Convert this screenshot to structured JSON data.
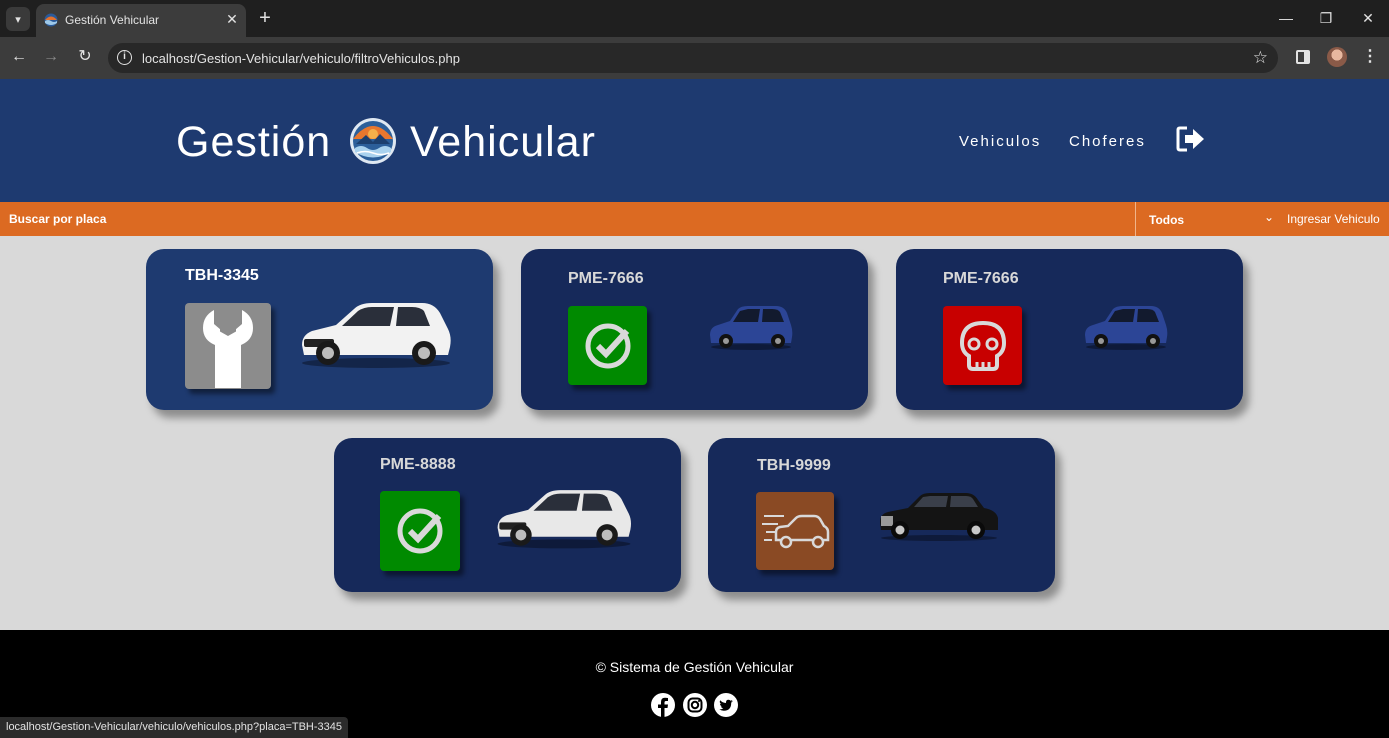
{
  "browser": {
    "tab_title": "Gestión Vehicular",
    "url": "localhost/Gestion-Vehicular/vehiculo/filtroVehiculos.php",
    "status_url": "localhost/Gestion-Vehicular/vehiculo/vehiculos.php?placa=TBH-3345",
    "icons": [
      "tab-menu-icon",
      "close-icon",
      "plus-icon",
      "minimize-icon",
      "restore-icon",
      "close-window-icon",
      "back-icon",
      "forward-icon",
      "reload-icon",
      "info-icon",
      "star-icon",
      "side-panel-icon",
      "kebab-icon"
    ]
  },
  "header": {
    "brand_left": "Gestión",
    "brand_right": "Vehicular",
    "nav": [
      "Vehiculos",
      "Choferes"
    ],
    "logout_icon": "logout-icon"
  },
  "filter_bar": {
    "search_label": "Buscar por placa",
    "select_value": "Todos",
    "add_label": "Ingresar Vehiculo"
  },
  "vehicles": [
    {
      "plate": "TBH-3345",
      "status": "maintenance",
      "status_icon": "wrench-icon",
      "status_color": "#8c8c8c",
      "car": "white-suv"
    },
    {
      "plate": "PME-7666",
      "status": "available",
      "status_icon": "check-circle-icon",
      "status_color": "#008a00",
      "car": "blue-suv"
    },
    {
      "plate": "PME-7666",
      "status": "out-of-service",
      "status_icon": "skull-icon",
      "status_color": "#c80000",
      "car": "blue-suv"
    },
    {
      "plate": "PME-8888",
      "status": "available",
      "status_icon": "check-circle-icon",
      "status_color": "#008a00",
      "car": "white-suv"
    },
    {
      "plate": "TBH-9999",
      "status": "in-transit",
      "status_icon": "moving-car-icon",
      "status_color": "#8a4a24",
      "car": "black-sedan"
    }
  ],
  "colors": {
    "header_bg": "#1e3a70",
    "card_bg": "#16295a",
    "filter_bar_bg": "#dc6a22",
    "page_bg": "#d9d9d9",
    "footer_bg": "#000000"
  },
  "footer": {
    "copyright": "© Sistema de Gestión Vehicular",
    "social_icons": [
      "facebook-icon",
      "instagram-icon",
      "twitter-icon"
    ]
  }
}
